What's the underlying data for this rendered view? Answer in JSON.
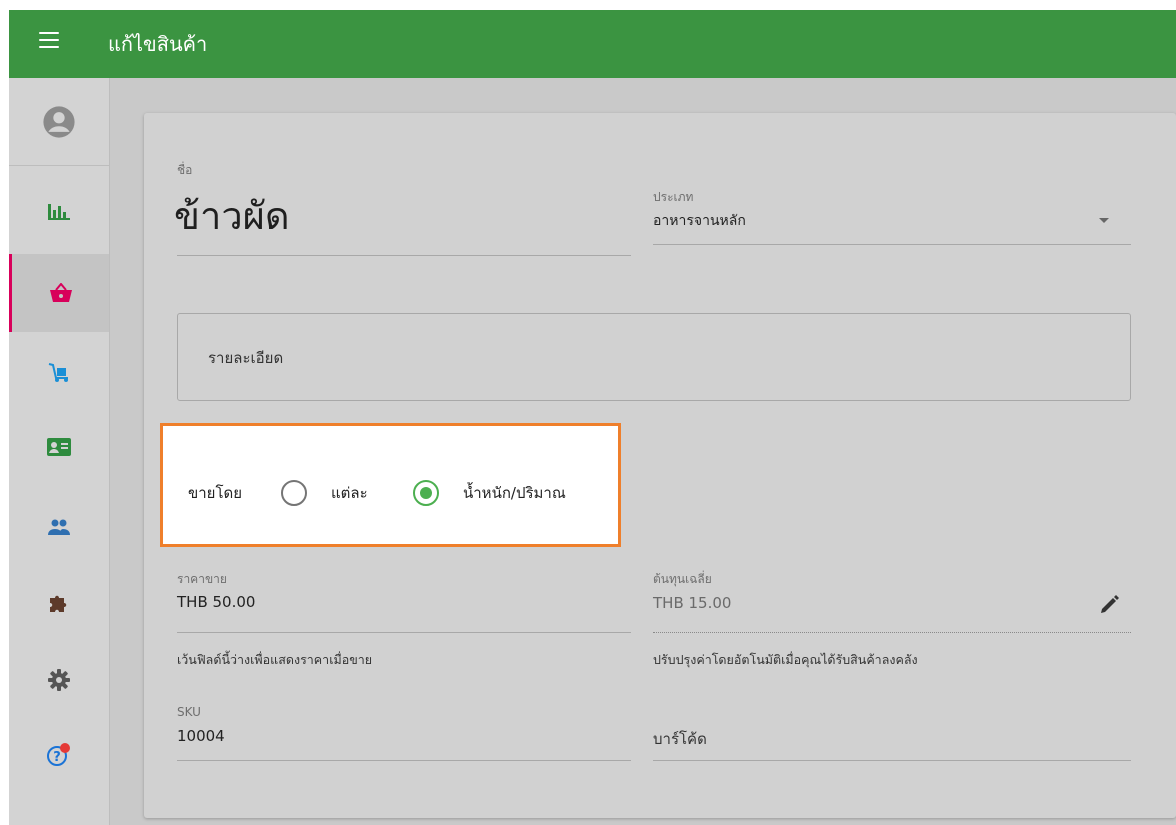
{
  "header": {
    "title": "แก้ไขสินค้า",
    "menu_icon": "hamburger-menu-icon"
  },
  "sidebar": {
    "avatar_icon": "account-circle-icon",
    "items": [
      {
        "icon": "bar-chart-icon",
        "color": "#2e8b3e"
      },
      {
        "icon": "shopping-basket-icon",
        "color": "#d8005a",
        "active": true
      },
      {
        "icon": "hand-truck-icon",
        "color": "#1a8fd6"
      },
      {
        "icon": "contact-card-icon",
        "color": "#2e8b3e"
      },
      {
        "icon": "people-icon",
        "color": "#2f6fb0"
      },
      {
        "icon": "puzzle-piece-icon",
        "color": "#5d3a2a"
      },
      {
        "icon": "gear-icon",
        "color": "#555555"
      },
      {
        "icon": "help-circle-icon",
        "color": "#1a73d6",
        "badge_color": "#e53935"
      }
    ]
  },
  "form": {
    "name_label": "ชื่อ",
    "name_value": "ข้าวผัด",
    "category_label": "ประเภท",
    "category_value": "อาหารจานหลัก",
    "description_placeholder": "รายละเอียด",
    "sell_by": {
      "label": "ขายโดย",
      "options": [
        "แต่ละ",
        "น้ำหนัก/ปริมาณ"
      ],
      "selected": "น้ำหนัก/ปริมาณ"
    },
    "price_label": "ราคาขาย",
    "price_value": "THB 50.00",
    "price_hint": "เว้นฟิลด์นี้ว่างเพื่อแสดงราคาเมื่อขาย",
    "cost_label": "ต้นทุนเฉลี่ย",
    "cost_value": "THB 15.00",
    "cost_hint": "ปรับปรุงค่าโดยอัตโนมัติเมื่อคุณได้รับสินค้าลงคลัง",
    "edit_icon": "pencil-icon",
    "sku_label": "SKU",
    "sku_value": "10004",
    "barcode_placeholder": "บาร์โค้ด"
  },
  "colors": {
    "topbar": "#3b9441",
    "accent": "#4caf50",
    "highlight_border": "#ef7f2b",
    "active_indicator": "#d8005a"
  }
}
